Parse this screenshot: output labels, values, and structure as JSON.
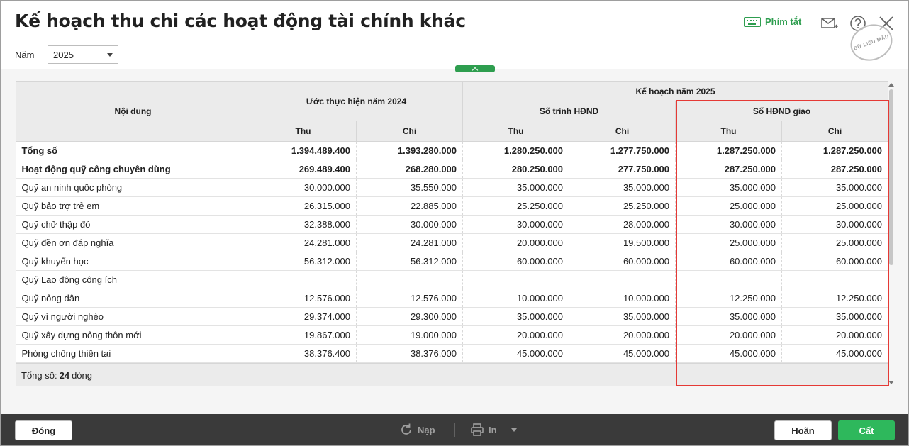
{
  "window": {
    "title": "Kế hoạch thu chi các hoạt động tài chính khác",
    "shortcut_label": "Phím tắt",
    "stamp_text": "DỮ LIỆU MẪU"
  },
  "filter": {
    "year_label": "Năm",
    "year_value": "2025"
  },
  "table": {
    "header": {
      "content": "Nội dung",
      "estimate_2024": "Ước thực hiện năm 2024",
      "plan_2025": "Kế hoạch năm 2025",
      "submitted": "Số trình HĐND",
      "assigned": "Số HĐND giao",
      "thu": "Thu",
      "chi": "Chi"
    },
    "rows": [
      {
        "name": "Tổng số",
        "bold": true,
        "v": [
          "1.394.489.400",
          "1.393.280.000",
          "1.280.250.000",
          "1.277.750.000",
          "1.287.250.000",
          "1.287.250.000"
        ]
      },
      {
        "name": "Hoạt động quỹ công chuyên dùng",
        "bold": true,
        "v": [
          "269.489.400",
          "268.280.000",
          "280.250.000",
          "277.750.000",
          "287.250.000",
          "287.250.000"
        ]
      },
      {
        "name": "Quỹ an ninh quốc phòng",
        "v": [
          "30.000.000",
          "35.550.000",
          "35.000.000",
          "35.000.000",
          "35.000.000",
          "35.000.000"
        ]
      },
      {
        "name": "Quỹ bảo trợ trẻ em",
        "v": [
          "26.315.000",
          "22.885.000",
          "25.250.000",
          "25.250.000",
          "25.000.000",
          "25.000.000"
        ]
      },
      {
        "name": "Quỹ chữ thập đỏ",
        "v": [
          "32.388.000",
          "30.000.000",
          "30.000.000",
          "28.000.000",
          "30.000.000",
          "30.000.000"
        ]
      },
      {
        "name": "Quỹ đền ơn đáp nghĩa",
        "v": [
          "24.281.000",
          "24.281.000",
          "20.000.000",
          "19.500.000",
          "25.000.000",
          "25.000.000"
        ]
      },
      {
        "name": "Quỹ khuyến học",
        "v": [
          "56.312.000",
          "56.312.000",
          "60.000.000",
          "60.000.000",
          "60.000.000",
          "60.000.000"
        ]
      },
      {
        "name": "Quỹ Lao động công ích",
        "v": [
          "",
          "",
          "",
          "",
          "",
          ""
        ]
      },
      {
        "name": "Quỹ nông dân",
        "v": [
          "12.576.000",
          "12.576.000",
          "10.000.000",
          "10.000.000",
          "12.250.000",
          "12.250.000"
        ]
      },
      {
        "name": "Quỹ vì người nghèo",
        "v": [
          "29.374.000",
          "29.300.000",
          "35.000.000",
          "35.000.000",
          "35.000.000",
          "35.000.000"
        ]
      },
      {
        "name": "Quỹ xây dựng nông thôn mới",
        "v": [
          "19.867.000",
          "19.000.000",
          "20.000.000",
          "20.000.000",
          "20.000.000",
          "20.000.000"
        ]
      },
      {
        "name": "Phòng chống thiên tai",
        "v": [
          "38.376.400",
          "38.376.000",
          "45.000.000",
          "45.000.000",
          "45.000.000",
          "45.000.000"
        ]
      }
    ],
    "footer": {
      "prefix": "Tổng số:",
      "count": "24",
      "suffix": "dòng"
    }
  },
  "actions": {
    "close": "Đóng",
    "reload": "Nạp",
    "print": "In",
    "cancel": "Hoãn",
    "save": "Cất"
  },
  "colors": {
    "accent": "#2e9e4f",
    "save": "#2eb85c",
    "highlight": "#e53935",
    "bottom_bar": "#3a3a3a"
  }
}
